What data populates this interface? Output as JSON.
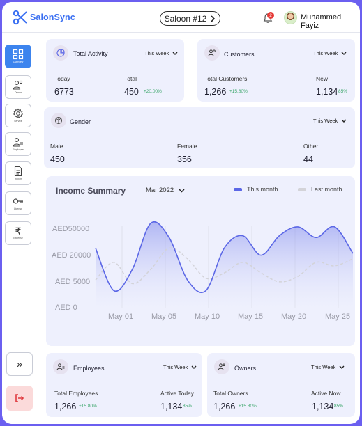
{
  "app": {
    "logo_salon": "Salon",
    "logo_sync": "Sync",
    "saloon_selector": "Saloon #12",
    "notification_count": "2",
    "user_name": "Muhammed Fayiz"
  },
  "sidebar": {
    "items": [
      {
        "label": "Overview",
        "icon": "grid-icon",
        "active": true
      },
      {
        "label": "Owner",
        "icon": "user-group-icon",
        "active": false
      },
      {
        "label": "Service",
        "icon": "gear-icon",
        "active": false
      },
      {
        "label": "Employee",
        "icon": "employee-icon",
        "active": false
      },
      {
        "label": "Report",
        "icon": "document-icon",
        "active": false
      },
      {
        "label": "License",
        "icon": "key-icon",
        "active": false
      },
      {
        "label": "Expense",
        "icon": "rupee-icon",
        "active": false
      }
    ],
    "expand_glyph": "»"
  },
  "total_activity": {
    "title": "Total Activity",
    "period": "This Week",
    "today_label": "Today",
    "today_value": "6773",
    "total_label": "Total",
    "total_value": "450",
    "total_change": "+20.00%"
  },
  "customers": {
    "title": "Customers",
    "period": "This Week",
    "total_label": "Total Customers",
    "total_value": "1,266",
    "total_change": "+15.80%",
    "new_label": "New",
    "new_value": "1,134",
    "new_pct": "85%"
  },
  "gender": {
    "title": "Gender",
    "period": "This Week",
    "male_label": "Male",
    "male_value": "450",
    "female_label": "Female",
    "female_value": "356",
    "other_label": "Other",
    "other_value": "44"
  },
  "income_summary": {
    "title": "Income Summary",
    "date": "Mar 2022",
    "legend_this": "This month",
    "legend_last": "Last month"
  },
  "employees": {
    "title": "Employees",
    "period": "This Week",
    "total_label": "Total Employees",
    "total_value": "1,266",
    "total_change": "+15.80%",
    "active_label": "Active Today",
    "active_value": "1,134",
    "active_pct": "85%"
  },
  "owners": {
    "title": "Owners",
    "period": "This Week",
    "total_label": "Total Owners",
    "total_value": "1,266",
    "total_change": "+15.80%",
    "active_label": "Active Now",
    "active_value": "1,134",
    "active_pct": "85%"
  },
  "colors": {
    "accent": "#3c84ee",
    "this_month": "#5b67e6",
    "last_month": "#d3d3d8",
    "positive": "#3aa66a",
    "card_bg": "#eef0fd"
  },
  "chart_data": {
    "type": "area",
    "title": "Income Summary",
    "x": [
      "May 01",
      "May 05",
      "May 10",
      "May 15",
      "May 20",
      "May 25"
    ],
    "yticks": [
      "AED50000",
      "AED 20000",
      "AED 5000",
      "AED 0"
    ],
    "series": [
      {
        "name": "This month",
        "values": [
          34000,
          10000,
          22000,
          48000,
          40000,
          16000,
          10000,
          34000,
          41000,
          30000,
          41000,
          46000,
          40000,
          46000,
          31000
        ]
      },
      {
        "name": "Last month",
        "values": [
          16000,
          26000,
          14000,
          22000,
          34000,
          28000,
          17000,
          20000,
          26000,
          20000,
          15000,
          18000,
          26000,
          24000,
          28000
        ]
      }
    ],
    "ylim": [
      0,
      55000
    ],
    "legend": "top-right",
    "grid": "vertical"
  }
}
